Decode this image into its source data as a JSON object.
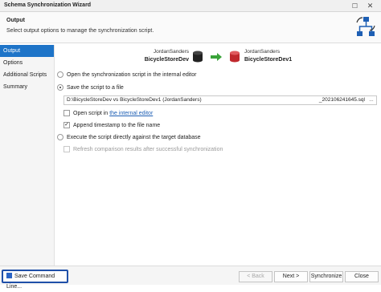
{
  "window": {
    "title": "Schema Synchronization Wizard"
  },
  "header": {
    "title": "Output",
    "description": "Select output options to manage the synchronization script."
  },
  "sidebar": {
    "items": [
      {
        "label": "Output",
        "active": true
      },
      {
        "label": "Options",
        "active": false
      },
      {
        "label": "Additional Scripts",
        "active": false
      },
      {
        "label": "Summary",
        "active": false
      }
    ]
  },
  "source": {
    "user": "JordanSanders",
    "database": "BicycleStoreDev"
  },
  "target": {
    "user": "JordanSanders",
    "database": "BicycleStoreDev1"
  },
  "options": {
    "open_in_editor": "Open the synchronization script in the internal editor",
    "save_to_file": "Save the script to a file",
    "file_path_left": "D:\\BicycleStoreDev vs BicycleStoreDev1 (JordanSanders)",
    "file_path_right": "_202106241645.sql",
    "browse": "...",
    "open_script_prefix": "Open script in",
    "open_script_link": "the internal editor",
    "append_timestamp": "Append timestamp to the file name",
    "execute_directly": "Execute the script directly against the target database",
    "refresh_results": "Refresh comparison results after successful synchronization"
  },
  "footer": {
    "save_command_line": "Save Command Line...",
    "back": "< Back",
    "next": "Next >",
    "synchronize": "Synchronize",
    "close": "Close"
  },
  "colors": {
    "accent": "#1e74c8",
    "source_db": "#222222",
    "target_db": "#c0282d",
    "arrow": "#3aa33a"
  },
  "icons": {
    "header": "schema-sync-icon",
    "source": "database-icon",
    "target": "database-icon",
    "arrow": "arrow-right-icon"
  }
}
